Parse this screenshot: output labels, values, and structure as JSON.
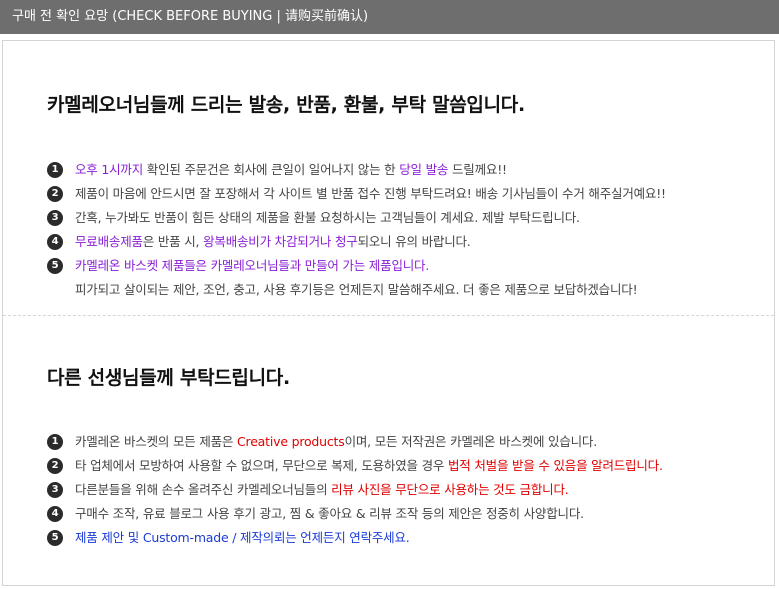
{
  "topbar": {
    "title": "구매 전 확인 요망 (CHECK BEFORE BUYING | 请购买前确认)"
  },
  "section1": {
    "heading": "카멜레오너님들께 드리는 발송, 반품, 환불, 부탁 말씀입니다.",
    "items": [
      {
        "num": "1",
        "a": "오후 1시까지",
        "b": " 확인된 주문건은 회사에 큰일이 일어나지 않는 한 ",
        "c": "당일 발송",
        "d": " 드릴께요!!"
      },
      {
        "num": "2",
        "text": "제품이 마음에 안드시면 잘 포장해서 각 사이트 별 반품 접수 진행 부탁드려요! 배송 기사님들이 수거 해주실거예요!!"
      },
      {
        "num": "3",
        "text": "간혹, 누가봐도 반품이 힘든 상태의 제품을 환불 요청하시는 고객님들이 계세요. 제발 부탁드립니다."
      },
      {
        "num": "4",
        "a": "무료배송제품",
        "b": "은 반품 시, ",
        "c": "왕복배송비가 차감되거나 청구",
        "d": "되오니 유의 바랍니다."
      },
      {
        "num": "5",
        "text": "카멜레온 바스켓 제품들은 카멜레오너님들과 만들어 가는 제품입니다."
      }
    ],
    "extra_line": "피가되고 살이되는 제안, 조언, 충고, 사용 후기등은 언제든지 말씀해주세요. 더 좋은 제품으로 보답하겠습니다!"
  },
  "section2": {
    "heading": "다른 선생님들께 부탁드립니다.",
    "items": [
      {
        "num": "1",
        "a": "카멜레온 바스켓의 모든 제품은 ",
        "b": "Creative products",
        "c": "이며, 모든 저작권은 카멜레온 바스켓에 있습니다."
      },
      {
        "num": "2",
        "a": "타 업체에서 모방하여 사용할 수 없으며, 무단으로 복제, 도용하였을 경우 ",
        "b": "법적 처벌을 받을 수 있음을 알려드립니다."
      },
      {
        "num": "3",
        "a": "다른분들을 위해 손수 올려주신 카멜레오너님들의 ",
        "b": "리뷰 사진을 무단으로 사용하는 것도 금합니다."
      },
      {
        "num": "4",
        "text": "구매수 조작, 유료 블로그 사용 후기 광고, 찜 & 좋아요 & 리뷰 조작 등의 제안은 정중히 사양합니다."
      },
      {
        "num": "5",
        "text": "제품 제안 및 Custom-made / 제작의뢰는 언제든지 연락주세요."
      }
    ]
  },
  "colors": {
    "topbar_bg": "#6e6e6e",
    "highlight_purple": "#8a1fd6",
    "highlight_red": "#e00000",
    "highlight_blue": "#1a3bd6"
  }
}
